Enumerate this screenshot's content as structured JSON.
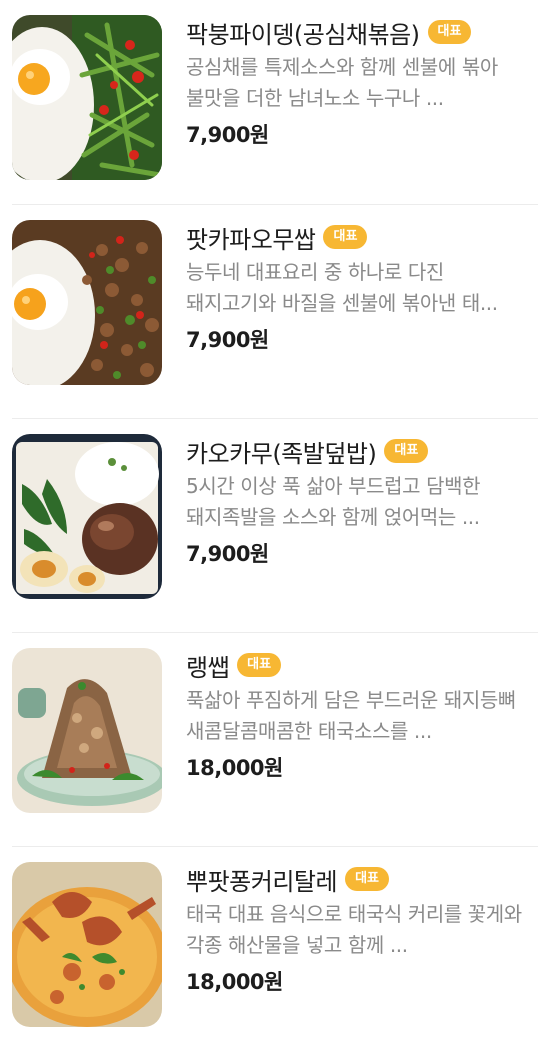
{
  "menu": {
    "items": [
      {
        "name": "팍붕파이뎅(공심채볶음)",
        "badge": "대표",
        "description": "공심채를 특제소스와 함께 센불에 볶아 불맛을 더한 남녀노소 누구나 ...",
        "price": "7,900원",
        "image_icon": "stir-fried-morning-glory-with-rice-and-egg-image"
      },
      {
        "name": "팟카파오무쌉",
        "badge": "대표",
        "description": "능두네 대표요리 중 하나로 다진 돼지고기와 바질을 센불에 볶아낸 태...",
        "price": "7,900원",
        "image_icon": "basil-pork-with-rice-and-egg-image"
      },
      {
        "name": "카오카무(족발덮밥)",
        "badge": "대표",
        "description": "5시간 이상 푹 삶아 부드럽고 담백한 돼지족발을 소스와 함께 얹어먹는 ...",
        "price": "7,900원",
        "image_icon": "braised-pork-leg-rice-box-image"
      },
      {
        "name": "랭쌥",
        "badge": "대표",
        "description": "푹삶아 푸짐하게 담은 부드러운 돼지등뼈 새콤달콤매콤한 태국소스를 ...",
        "price": "18,000원",
        "image_icon": "spicy-pork-bone-tower-image"
      },
      {
        "name": "뿌팟퐁커리탈레",
        "badge": "대표",
        "description": "태국 대표 음식으로 태국식 커리를 꽃게와 각종 해산물을 넣고 함께 ...",
        "price": "18,000원",
        "image_icon": "crab-curry-image"
      }
    ]
  },
  "colors": {
    "badge": "#f7b733",
    "title": "#1d1d1d",
    "description": "#8a8a8a",
    "divider": "#ececec"
  }
}
